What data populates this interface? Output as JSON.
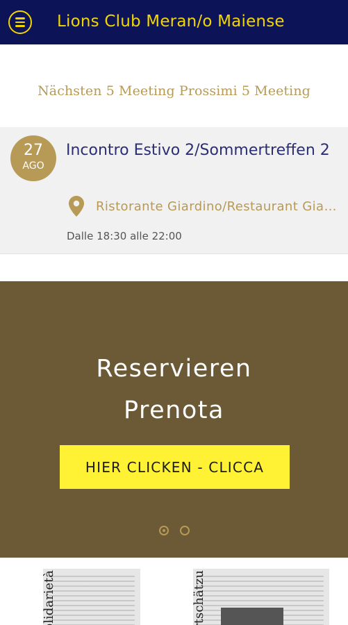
{
  "header": {
    "title": "Lions Club Meran/o Maiense",
    "menu_icon": "hamburger-menu-icon",
    "background_color": "#0d1357",
    "accent_color": "#f2d600"
  },
  "upcoming": {
    "heading": "Nächsten 5 Meeting Prossimi 5 Meeting"
  },
  "meetings": [
    {
      "day": "27",
      "month": "AGO",
      "title": "Incontro Estivo 2/Sommertreffen 2",
      "location_icon": "location-pin-icon",
      "location": "Ristorante Giardino/Restaurant Giardino",
      "time": "Dalle 18:30 alle 22:00"
    }
  ],
  "promo": {
    "line1": "Reservieren",
    "line2": "Prenota",
    "button_label": "HIER CLICKEN - CLICCA",
    "background_color": "#6b5a35",
    "button_color": "#fff234",
    "slide_count": 2,
    "active_slide": 1
  },
  "gallery": {
    "items": [
      {
        "headline": "olidarietà"
      },
      {
        "headline": "rtschätzu"
      }
    ]
  }
}
